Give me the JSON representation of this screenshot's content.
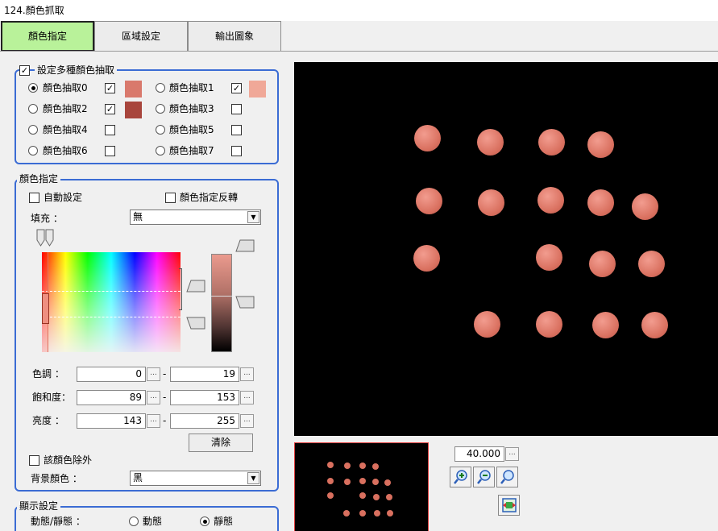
{
  "window": {
    "title": "124.顏色抓取"
  },
  "tabs": [
    {
      "label": "顏色指定"
    },
    {
      "label": "區域設定"
    },
    {
      "label": "輸出圖象"
    }
  ],
  "extract": {
    "group_label": "設定多種顏色抽取",
    "items": [
      {
        "label": "顏色抽取0",
        "selected": true,
        "checked": true,
        "color": "#d9796c"
      },
      {
        "label": "顏色抽取1",
        "selected": false,
        "checked": true,
        "color": "#f0a898"
      },
      {
        "label": "顏色抽取2",
        "selected": false,
        "checked": true,
        "color": "#a8453c"
      },
      {
        "label": "顏色抽取3",
        "selected": false,
        "checked": false,
        "color": ""
      },
      {
        "label": "顏色抽取4",
        "selected": false,
        "checked": false,
        "color": ""
      },
      {
        "label": "顏色抽取5",
        "selected": false,
        "checked": false,
        "color": ""
      },
      {
        "label": "顏色抽取6",
        "selected": false,
        "checked": false,
        "color": ""
      },
      {
        "label": "顏色抽取7",
        "selected": false,
        "checked": false,
        "color": ""
      }
    ]
  },
  "color": {
    "group_label": "顏色指定",
    "auto_label": "自動設定",
    "invert_label": "顏色指定反轉",
    "fill_label": "填充 ：",
    "fill_value": "無",
    "hue": {
      "label": "色調 ：",
      "min": "0",
      "max": "19"
    },
    "saturation": {
      "label": "飽和度：",
      "min": "89",
      "max": "153"
    },
    "brightness": {
      "label": "亮度 ：",
      "min": "143",
      "max": "255"
    },
    "dash": "-",
    "dots": "...",
    "clear_label": "清除",
    "exclude_label": "該顏色除外",
    "bg_label": "背景顏色 ：",
    "bg_value": "黑"
  },
  "display": {
    "group_label": "顯示設定",
    "mode_label": "動態/靜態 ：",
    "dynamic_label": "動態",
    "static_label": "靜態"
  },
  "zoom": {
    "value": "40.000"
  },
  "colors": {
    "accent": "#3b6cd4",
    "active_tab": "#b9f29a",
    "blob": "#d9705f"
  }
}
